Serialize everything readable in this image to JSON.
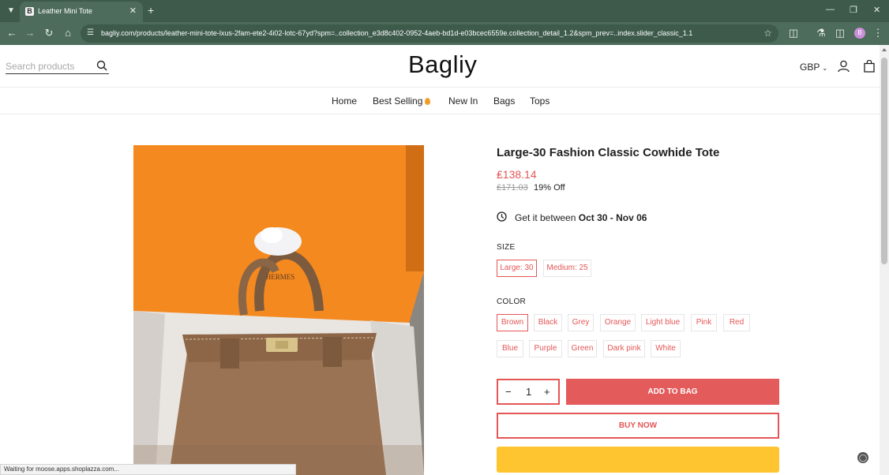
{
  "browser": {
    "tab_title": "Leather Mini Tote",
    "tab_favicon": "B",
    "url": "bagliy.com/products/leather-mini-tote-lxus-2fam-ete2-4i02-lotc-67yd?spm=..collection_e3d8c402-0952-4aeb-bd1d-e03bcec6559e.collection_detail_1.2&spm_prev=..index.slider_classic_1.1",
    "profile_initial": "B",
    "status_text": "Waiting for moose.apps.shoplazza.com..."
  },
  "header": {
    "search_placeholder": "Search products",
    "logo": "Bagliy",
    "currency": "GBP"
  },
  "nav": {
    "items": [
      "Home",
      "Best Selling",
      "New In",
      "Bags",
      "Tops"
    ]
  },
  "product": {
    "title": "Large-30 Fashion Classic Cowhide Tote",
    "price": "₤138.14",
    "old_price": "₤171.03",
    "discount": "19% Off",
    "delivery_prefix": "Get it between",
    "delivery_dates": "Oct 30 - Nov 06",
    "image_brand": "HERMES"
  },
  "options": {
    "size_label": "SIZE",
    "sizes": [
      "Large: 30",
      "Medium: 25"
    ],
    "selected_size": "Large: 30",
    "color_label": "COLOR",
    "colors": [
      "Brown",
      "Black",
      "Grey",
      "Orange",
      "Light blue",
      "Pink",
      "Red",
      "Blue",
      "Purple",
      "Green",
      "Dark pink",
      "White"
    ],
    "selected_color": "Brown"
  },
  "purchase": {
    "quantity": "1",
    "minus": "−",
    "plus": "+",
    "add_to_bag": "ADD TO BAG",
    "buy_now": "BUY NOW"
  },
  "colors": {
    "accent": "#e45656",
    "chrome": "#4d6c5b",
    "pay_button": "#ffc531"
  }
}
